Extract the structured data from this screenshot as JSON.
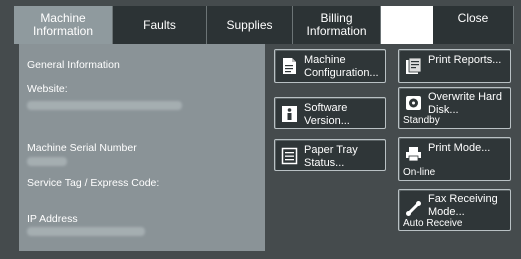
{
  "tabs": [
    {
      "label": "Machine Information",
      "active": true
    },
    {
      "label": "Faults",
      "active": false
    },
    {
      "label": "Supplies",
      "active": false
    },
    {
      "label": "Billing Information",
      "active": false
    },
    {
      "label": "",
      "active": false
    },
    {
      "label": "Close",
      "active": false
    }
  ],
  "general": {
    "heading": "General Information",
    "website_label": "Website:",
    "serial_label": "Machine Serial Number",
    "service_tag_label": "Service Tag / Express Code:",
    "ip_label": "IP Address"
  },
  "buttons": {
    "machine_config": {
      "label": "Machine Configuration...",
      "icon": "document-icon"
    },
    "software_version": {
      "label": "Software Version...",
      "icon": "info-icon"
    },
    "paper_tray": {
      "label": "Paper Tray Status...",
      "icon": "list-icon"
    },
    "print_reports": {
      "label": "Print Reports...",
      "icon": "report-icon"
    },
    "overwrite_disk": {
      "label": "Overwrite Hard Disk...",
      "icon": "disk-icon",
      "status": "Standby"
    },
    "print_mode": {
      "label": "Print Mode...",
      "icon": "printer-icon",
      "status": "On-line"
    },
    "fax_receiving": {
      "label": "Fax Receiving Mode...",
      "icon": "phone-icon",
      "status": "Auto Receive"
    }
  },
  "colors": {
    "background": "#454b4d",
    "active_tab": "#8f9a9e",
    "panel": "#8a9397",
    "button": "#2f3638"
  }
}
